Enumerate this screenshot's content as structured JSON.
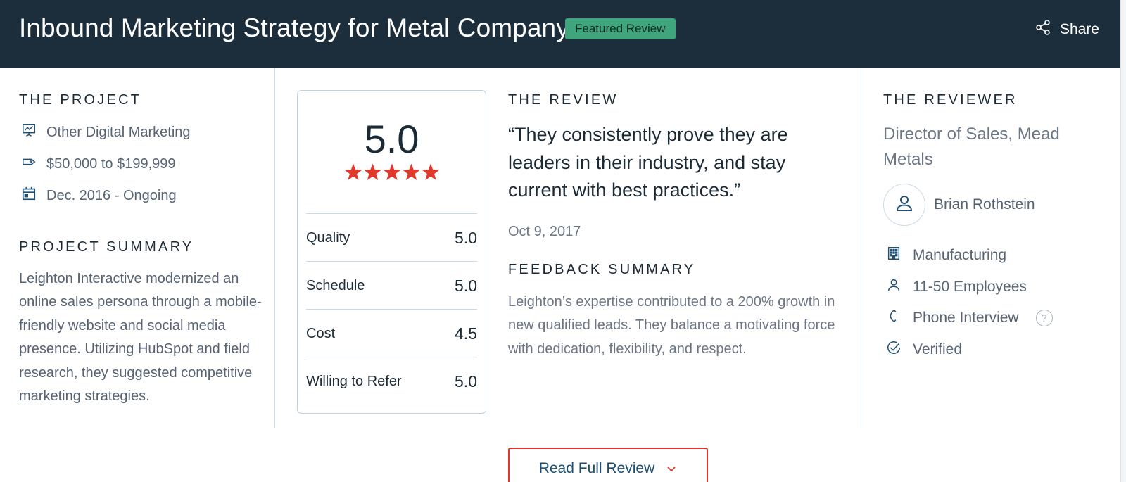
{
  "header": {
    "title": "Inbound Marketing Strategy for Metal Company",
    "badge": "Featured Review",
    "share_label": "Share"
  },
  "project": {
    "section_title": "THE PROJECT",
    "service": "Other Digital Marketing",
    "budget": "$50,000 to $199,999",
    "dates": "Dec. 2016 - Ongoing",
    "summary_title": "PROJECT SUMMARY",
    "summary": "Leighton Interactive modernized an online sales persona through a mobile-friendly website and social media presence. Utilizing HubSpot and field research, they suggested competitive marketing strategies."
  },
  "rating": {
    "overall": "5.0",
    "stars": 5,
    "star_color": "#e0382b",
    "rows": [
      {
        "label": "Quality",
        "value": "5.0"
      },
      {
        "label": "Schedule",
        "value": "5.0"
      },
      {
        "label": "Cost",
        "value": "4.5"
      },
      {
        "label": "Willing to Refer",
        "value": "5.0"
      }
    ]
  },
  "review": {
    "section_title": "THE REVIEW",
    "quote": "“They consistently prove they are leaders in their industry, and stay current with best practices.”",
    "date": "Oct 9, 2017",
    "feedback_title": "FEEDBACK SUMMARY",
    "feedback": "Leighton’s expertise contributed to a 200% growth in new qualified leads. They balance a motivating force with dedication, flexibility, and respect."
  },
  "reviewer": {
    "section_title": "THE REVIEWER",
    "title": "Director of Sales, Mead Metals",
    "name": "Brian Rothstein",
    "industry": "Manufacturing",
    "company_size": "11-50 Employees",
    "interview_type": "Phone Interview",
    "help_icon_text": "?",
    "verification": "Verified"
  },
  "actions": {
    "read_full_label": "Read Full Review"
  },
  "colors": {
    "header_bg": "#1c2d3b",
    "badge_bg": "#3fa57d",
    "accent_blue": "#1d4e73",
    "button_border": "#e0382b"
  },
  "icons": {
    "share": "share-icon",
    "service": "presentation-chart-icon",
    "budget": "price-tag-icon",
    "dates": "calendar-icon",
    "star": "star-icon",
    "avatar": "user-icon",
    "industry": "building-icon",
    "company_size": "user-icon",
    "interview": "phone-icon",
    "help": "question-icon",
    "verified": "check-circle-icon",
    "read_more": "chevron-down-icon"
  }
}
